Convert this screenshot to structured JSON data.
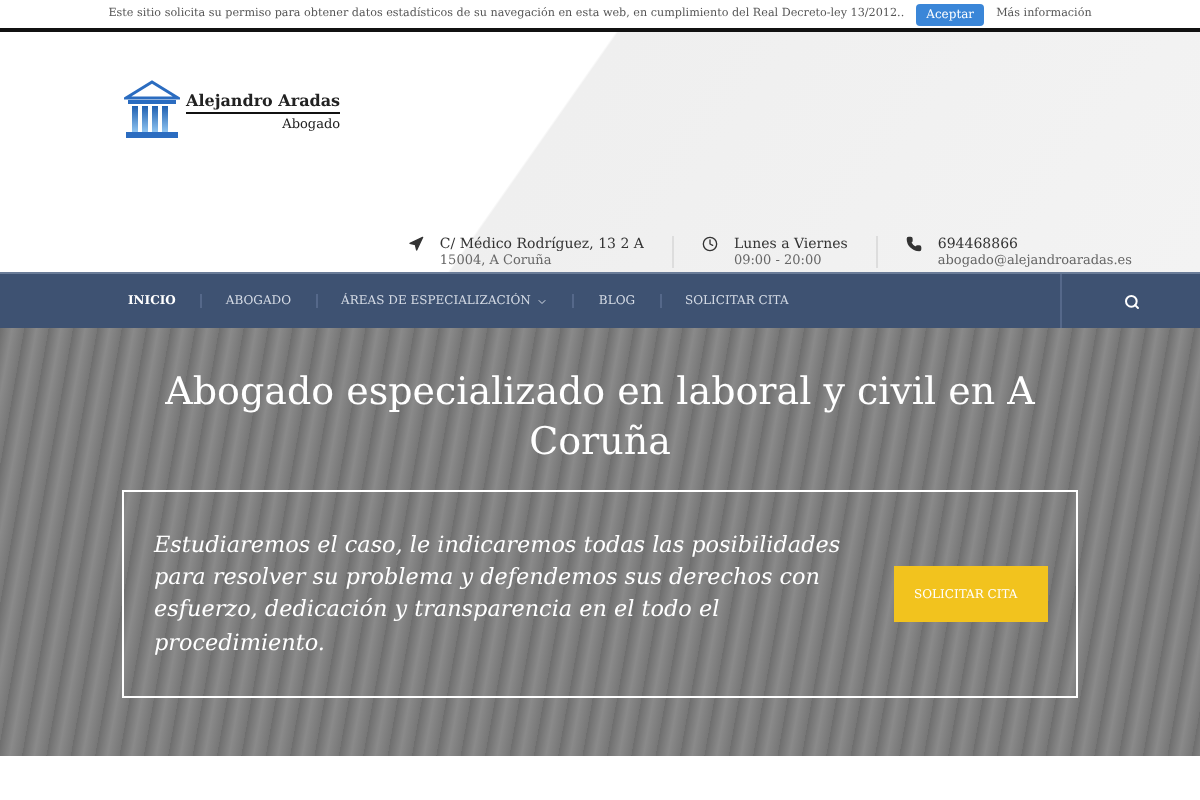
{
  "cookie_bar": {
    "message": "Este sitio solicita su permiso para obtener datos estadísticos de su navegación en esta web, en cumplimiento del Real Decreto-ley 13/2012..",
    "accept_button": "Aceptar",
    "more_link": "Más información"
  },
  "logo": {
    "name": "Alejandro Aradas",
    "subtitle": "Abogado"
  },
  "contact": [
    {
      "kind": "location",
      "line1": "C/ Médico Rodríguez, 13 2 A",
      "line2": "15004, A Coruña"
    },
    {
      "kind": "clock",
      "line1": "Lunes a Viernes",
      "line2": "09:00 - 20:00"
    },
    {
      "kind": "phone",
      "line1": "694468866",
      "line2": "abogado@alejandroaradas.es"
    }
  ],
  "nav": [
    {
      "label": "INICIO",
      "selected": true,
      "dropdown": false
    },
    {
      "label": "ABOGADO",
      "selected": false,
      "dropdown": false
    },
    {
      "label": "ÁREAS DE ESPECIALIZACIÓN",
      "selected": false,
      "dropdown": true
    },
    {
      "label": "BLOG",
      "selected": false,
      "dropdown": false
    },
    {
      "label": "SOLICITAR CITA",
      "selected": false,
      "dropdown": false
    }
  ],
  "hero": {
    "title": "Abogado especializado en laboral y civil en A Coruña",
    "text": "Estudiaremos el caso, le indicaremos todas las posibilidades para resolver su problema y defendemos sus derechos con esfuerzo, dedicación y transparencia en el todo el procedimiento.",
    "button": "SOLICITAR CITA"
  }
}
